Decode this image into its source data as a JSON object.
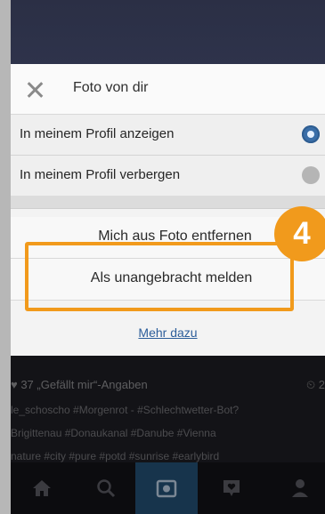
{
  "sheet": {
    "title": "Foto von dir",
    "options": [
      {
        "label": "In meinem Profil anzeigen",
        "selected": true
      },
      {
        "label": "In meinem Profil verbergen",
        "selected": false
      }
    ],
    "actions": {
      "remove": "Mich aus Foto entfernen",
      "report": "Als unangebracht melden"
    },
    "more_link": "Mehr dazu"
  },
  "annotation": {
    "badge": "4",
    "color": "#f19a1c"
  },
  "feed": {
    "likes": "♥ 37 „Gefällt mir“-Angaben",
    "time": "⏲ 2",
    "caption_lines": [
      "le_schoscho #Morgenrot - #Schlechtwetter-Bot?",
      "Brigittenau #Donaukanal #Danube #Vienna",
      "nature #city #pure #potd #sunrise #earlybird"
    ]
  },
  "nav": {
    "items": [
      "home-icon",
      "search-icon",
      "camera-icon",
      "activity-icon",
      "profile-icon"
    ],
    "selected": "camera-icon"
  },
  "colors": {
    "accent": "#3a6ea8",
    "annotation": "#f19a1c",
    "topbar": "#2e334b"
  }
}
